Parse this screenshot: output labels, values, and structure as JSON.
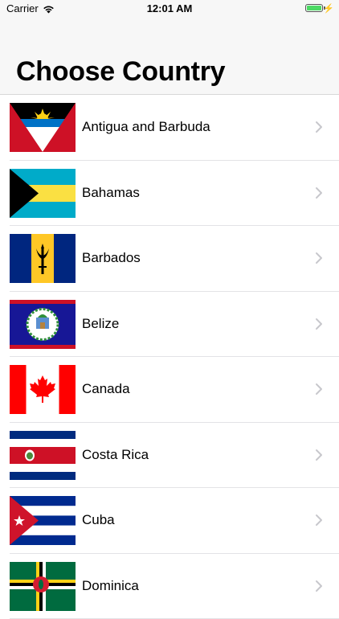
{
  "status_bar": {
    "carrier": "Carrier",
    "time": "12:01 AM",
    "battery_level": 1.0,
    "battery_color": "#4cd964"
  },
  "nav": {
    "title": "Choose Country"
  },
  "countries": [
    {
      "name": "Antigua and Barbuda",
      "flag_icon": "flag-antigua-and-barbuda"
    },
    {
      "name": "Bahamas",
      "flag_icon": "flag-bahamas"
    },
    {
      "name": "Barbados",
      "flag_icon": "flag-barbados"
    },
    {
      "name": "Belize",
      "flag_icon": "flag-belize"
    },
    {
      "name": "Canada",
      "flag_icon": "flag-canada"
    },
    {
      "name": "Costa Rica",
      "flag_icon": "flag-costa-rica"
    },
    {
      "name": "Cuba",
      "flag_icon": "flag-cuba"
    },
    {
      "name": "Dominica",
      "flag_icon": "flag-dominica"
    }
  ]
}
